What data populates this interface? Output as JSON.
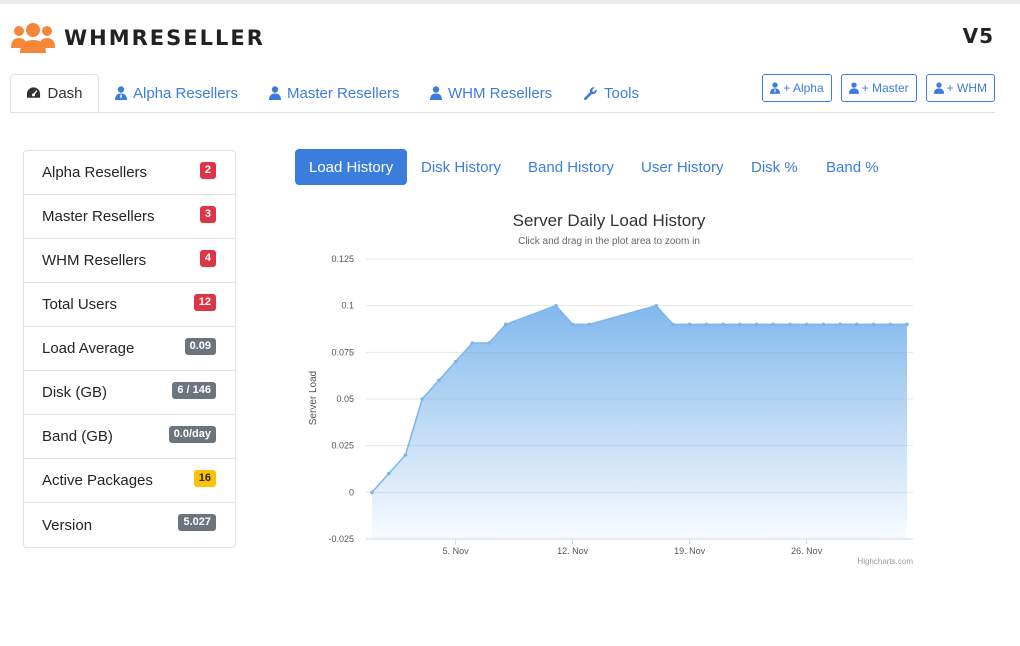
{
  "brand": {
    "name": "WHMRESELLER",
    "version": "V5",
    "accent": "#f5863a"
  },
  "nav": {
    "tabs": [
      {
        "label": "Dash",
        "icon": "dashboard-icon",
        "active": true
      },
      {
        "label": "Alpha Resellers",
        "icon": "user-tie-icon"
      },
      {
        "label": "Master Resellers",
        "icon": "user-icon"
      },
      {
        "label": "WHM Resellers",
        "icon": "user-icon"
      },
      {
        "label": "Tools",
        "icon": "wrench-icon"
      }
    ],
    "add_buttons": [
      {
        "label": "+ Alpha",
        "icon": "user-tie-icon"
      },
      {
        "label": "+ Master",
        "icon": "user-icon"
      },
      {
        "label": "+ WHM",
        "icon": "user-icon"
      }
    ]
  },
  "stats": [
    {
      "label": "Alpha Resellers",
      "value": "2",
      "color": "#dc3545"
    },
    {
      "label": "Master Resellers",
      "value": "3",
      "color": "#dc3545"
    },
    {
      "label": "WHM Resellers",
      "value": "4",
      "color": "#dc3545"
    },
    {
      "label": "Total Users",
      "value": "12",
      "color": "#dc3545"
    },
    {
      "label": "Load Average",
      "value": "0.09",
      "color": "#6c757d"
    },
    {
      "label": "Disk (GB)",
      "value": "6 / 146",
      "color": "#6c757d"
    },
    {
      "label": "Band (GB)",
      "value": "0.0/day",
      "color": "#6c757d"
    },
    {
      "label": "Active Packages",
      "value": "16",
      "color": "#ffc107"
    },
    {
      "label": "Version",
      "value": "5.027",
      "color": "#6c757d"
    }
  ],
  "chart_tabs": [
    "Load History",
    "Disk History",
    "Band History",
    "User History",
    "Disk %",
    "Band %"
  ],
  "chart_data": {
    "type": "area",
    "title": "Server Daily Load History",
    "subtitle": "Click and drag in the plot area to zoom in",
    "ylabel": "Server Load",
    "ylim": [
      -0.025,
      0.125
    ],
    "yticks": [
      "0.125",
      "0.1",
      "0.075",
      "0.05",
      "0.025",
      "0",
      "-0.025"
    ],
    "ytick_values": [
      0.125,
      0.1,
      0.075,
      0.05,
      0.025,
      0,
      -0.025
    ],
    "xticks": [
      "5. Nov",
      "12. Nov",
      "19. Nov",
      "26. Nov"
    ],
    "xtick_days": [
      5,
      12,
      19,
      26
    ],
    "x_days": [
      0,
      1,
      2,
      3,
      4,
      5,
      6,
      7,
      8,
      11,
      12,
      13,
      17,
      18,
      19,
      20,
      21,
      22,
      23,
      24,
      25,
      26,
      27,
      28,
      29,
      30,
      31,
      32
    ],
    "values": [
      0,
      0.01,
      0.02,
      0.05,
      0.06,
      0.07,
      0.08,
      0.08,
      0.09,
      0.1,
      0.09,
      0.09,
      0.1,
      0.09,
      0.09,
      0.09,
      0.09,
      0.09,
      0.09,
      0.09,
      0.09,
      0.09,
      0.09,
      0.09,
      0.09,
      0.09,
      0.09,
      0.09
    ],
    "series_color": "#7cb5ec",
    "credit": "Highcharts.com"
  }
}
